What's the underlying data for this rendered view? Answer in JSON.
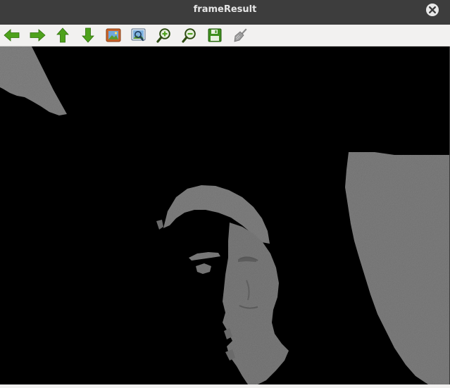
{
  "window": {
    "title": "frameResult"
  },
  "toolbar": {
    "items": [
      {
        "name": "pan-left",
        "icon": "arrow-left-icon"
      },
      {
        "name": "pan-right",
        "icon": "arrow-right-icon"
      },
      {
        "name": "pan-up",
        "icon": "arrow-up-icon"
      },
      {
        "name": "pan-down",
        "icon": "arrow-down-icon"
      },
      {
        "name": "zoom-fit",
        "icon": "picture-icon"
      },
      {
        "name": "zoom-region",
        "icon": "zoom-region-icon"
      },
      {
        "name": "zoom-in",
        "icon": "zoom-in-icon"
      },
      {
        "name": "zoom-out",
        "icon": "zoom-out-icon"
      },
      {
        "name": "save-image",
        "icon": "save-icon"
      },
      {
        "name": "properties",
        "icon": "brush-icon"
      }
    ]
  },
  "colors": {
    "titlebar": "#3d3d3d",
    "toolbar": "#f2f1f0",
    "arrow_green": "#4ea21c",
    "image_background": "#000000",
    "depth_gray": "#6e6e6e"
  }
}
